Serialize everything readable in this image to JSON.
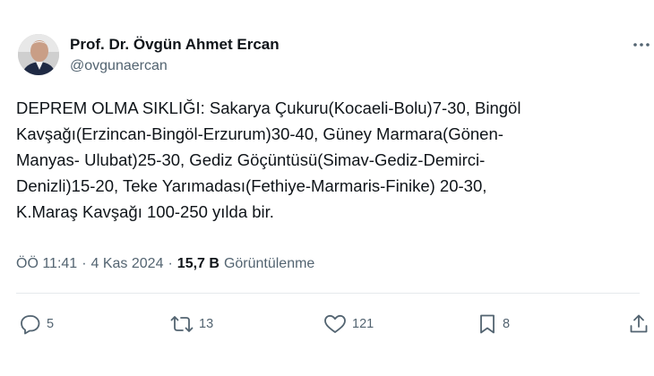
{
  "author": {
    "name": "Prof. Dr. Övgün Ahmet Ercan",
    "handle": "@ovgunaercan",
    "avatar_icon": "profile-photo"
  },
  "tweet": {
    "lines": [
      "DEPREM OLMA SIKLIĞI: Sakarya Çukuru(Kocaeli-Bolu)7-30, Bingöl",
      "Kavşağı(Erzincan-Bingöl-Erzurum)30-40, Güney Marmara(Gönen-",
      "Manyas- Ulubat)25-30, Gediz Göçüntüsü(Simav-Gediz-Demirci-",
      "Denizli)15-20, Teke Yarımadası(Fethiye-Marmaris-Finike) 20-30,",
      "K.Maraş Kavşağı 100-250 yılda bir."
    ]
  },
  "meta": {
    "time": "ÖÖ 11:41",
    "separator": "·",
    "date": "4 Kas 2024",
    "views_count": "15,7 B",
    "views_label": "Görüntülenme"
  },
  "actions": {
    "reply": {
      "icon": "reply-icon",
      "count": "5"
    },
    "repost": {
      "icon": "repost-icon",
      "count": "13"
    },
    "like": {
      "icon": "heart-icon",
      "count": "121"
    },
    "bookmark": {
      "icon": "bookmark-icon",
      "count": "8"
    },
    "share": {
      "icon": "share-icon"
    }
  },
  "colors": {
    "text": "#0f1419",
    "secondary": "#536471",
    "divider": "#e6e9ec"
  }
}
